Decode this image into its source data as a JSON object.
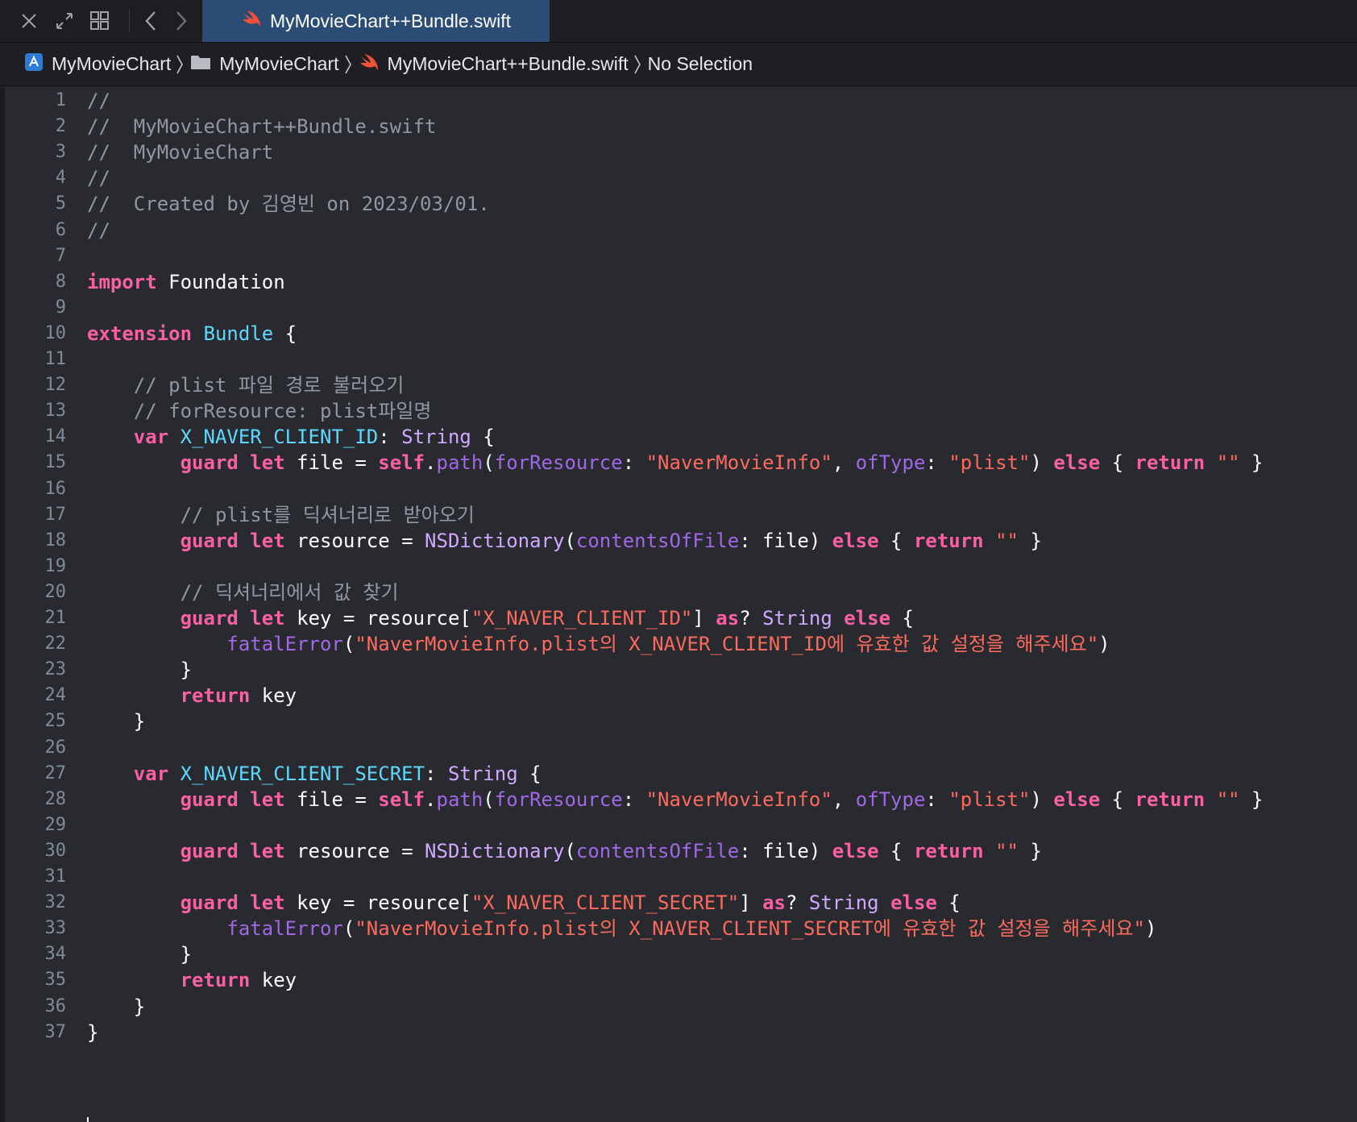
{
  "tabbar": {
    "active_tab_label": "MyMovieChart++Bundle.swift",
    "icons": [
      "close-icon",
      "expand-icon",
      "grid-icon",
      "back-icon",
      "forward-icon"
    ]
  },
  "jumpbar": {
    "project": "MyMovieChart",
    "group": "MyMovieChart",
    "file": "MyMovieChart++Bundle.swift",
    "selection": "No Selection"
  },
  "colors": {
    "comment": "#8d98a3",
    "keyword": "#fc5fa3",
    "type": "#d0a8ff",
    "declared_type": "#5dd8ff",
    "property": "#41a1c0",
    "function": "#a167e6",
    "string": "#fc6a5d",
    "tab_active": "#2b4c74",
    "editor_bg": "#292a30"
  },
  "code_lines": [
    [
      [
        "cm",
        "//"
      ]
    ],
    [
      [
        "cm",
        "//  MyMovieChart++Bundle.swift"
      ]
    ],
    [
      [
        "cm",
        "//  MyMovieChart"
      ]
    ],
    [
      [
        "cm",
        "//"
      ]
    ],
    [
      [
        "cm",
        "//  Created by 김영빈 on 2023/03/01."
      ]
    ],
    [
      [
        "cm",
        "//"
      ]
    ],
    [],
    [
      [
        "kw",
        "import"
      ],
      [
        "pl",
        " Foundation"
      ]
    ],
    [],
    [
      [
        "kw",
        "extension"
      ],
      [
        "pl",
        " "
      ],
      [
        "bt",
        "Bundle"
      ],
      [
        "pl",
        " {"
      ]
    ],
    [],
    [
      [
        "cm",
        "    // plist 파일 경로 불러오기"
      ]
    ],
    [
      [
        "cm",
        "    // forResource: plist파일명"
      ]
    ],
    [
      [
        "pl",
        "    "
      ],
      [
        "kw",
        "var"
      ],
      [
        "pl",
        " "
      ],
      [
        "bt",
        "X_NAVER_CLIENT_ID"
      ],
      [
        "pl",
        ": "
      ],
      [
        "ty",
        "String"
      ],
      [
        "pl",
        " {"
      ]
    ],
    [
      [
        "pl",
        "        "
      ],
      [
        "kw",
        "guard"
      ],
      [
        "pl",
        " "
      ],
      [
        "kw",
        "let"
      ],
      [
        "pl",
        " file = "
      ],
      [
        "kw",
        "self"
      ],
      [
        "pl",
        "."
      ],
      [
        "fn",
        "path"
      ],
      [
        "pl",
        "("
      ],
      [
        "fn",
        "forResource"
      ],
      [
        "pl",
        ": "
      ],
      [
        "st",
        "\"NaverMovieInfo\""
      ],
      [
        "pl",
        ", "
      ],
      [
        "fn",
        "ofType"
      ],
      [
        "pl",
        ": "
      ],
      [
        "st",
        "\"plist\""
      ],
      [
        "pl",
        ") "
      ],
      [
        "kw",
        "else"
      ],
      [
        "pl",
        " { "
      ],
      [
        "kw",
        "return"
      ],
      [
        "pl",
        " "
      ],
      [
        "st",
        "\"\""
      ],
      [
        "pl",
        " }"
      ]
    ],
    [],
    [
      [
        "cm",
        "        // plist를 딕셔너리로 받아오기"
      ]
    ],
    [
      [
        "pl",
        "        "
      ],
      [
        "kw",
        "guard"
      ],
      [
        "pl",
        " "
      ],
      [
        "kw",
        "let"
      ],
      [
        "pl",
        " resource = "
      ],
      [
        "ty",
        "NSDictionary"
      ],
      [
        "pl",
        "("
      ],
      [
        "fn",
        "contentsOfFile"
      ],
      [
        "pl",
        ": file) "
      ],
      [
        "kw",
        "else"
      ],
      [
        "pl",
        " { "
      ],
      [
        "kw",
        "return"
      ],
      [
        "pl",
        " "
      ],
      [
        "st",
        "\"\""
      ],
      [
        "pl",
        " }"
      ]
    ],
    [],
    [
      [
        "cm",
        "        // 딕셔너리에서 값 찾기"
      ]
    ],
    [
      [
        "pl",
        "        "
      ],
      [
        "kw",
        "guard"
      ],
      [
        "pl",
        " "
      ],
      [
        "kw",
        "let"
      ],
      [
        "pl",
        " key = resource["
      ],
      [
        "st",
        "\"X_NAVER_CLIENT_ID\""
      ],
      [
        "pl",
        "] "
      ],
      [
        "kw",
        "as"
      ],
      [
        "pl",
        "? "
      ],
      [
        "ty",
        "String"
      ],
      [
        "pl",
        " "
      ],
      [
        "kw",
        "else"
      ],
      [
        "pl",
        " {"
      ]
    ],
    [
      [
        "pl",
        "            "
      ],
      [
        "fn",
        "fatalError"
      ],
      [
        "pl",
        "("
      ],
      [
        "st",
        "\"NaverMovieInfo.plist의 X_NAVER_CLIENT_ID에 유효한 값 설정을 해주세요\""
      ],
      [
        "pl",
        ")"
      ]
    ],
    [
      [
        "pl",
        "        }"
      ]
    ],
    [
      [
        "pl",
        "        "
      ],
      [
        "kw",
        "return"
      ],
      [
        "pl",
        " key"
      ]
    ],
    [
      [
        "pl",
        "    }"
      ]
    ],
    [],
    [
      [
        "pl",
        "    "
      ],
      [
        "kw",
        "var"
      ],
      [
        "pl",
        " "
      ],
      [
        "bt",
        "X_NAVER_CLIENT_SECRET"
      ],
      [
        "pl",
        ": "
      ],
      [
        "ty",
        "String"
      ],
      [
        "pl",
        " {"
      ]
    ],
    [
      [
        "pl",
        "        "
      ],
      [
        "kw",
        "guard"
      ],
      [
        "pl",
        " "
      ],
      [
        "kw",
        "let"
      ],
      [
        "pl",
        " file = "
      ],
      [
        "kw",
        "self"
      ],
      [
        "pl",
        "."
      ],
      [
        "fn",
        "path"
      ],
      [
        "pl",
        "("
      ],
      [
        "fn",
        "forResource"
      ],
      [
        "pl",
        ": "
      ],
      [
        "st",
        "\"NaverMovieInfo\""
      ],
      [
        "pl",
        ", "
      ],
      [
        "fn",
        "ofType"
      ],
      [
        "pl",
        ": "
      ],
      [
        "st",
        "\"plist\""
      ],
      [
        "pl",
        ") "
      ],
      [
        "kw",
        "else"
      ],
      [
        "pl",
        " { "
      ],
      [
        "kw",
        "return"
      ],
      [
        "pl",
        " "
      ],
      [
        "st",
        "\"\""
      ],
      [
        "pl",
        " }"
      ]
    ],
    [],
    [
      [
        "pl",
        "        "
      ],
      [
        "kw",
        "guard"
      ],
      [
        "pl",
        " "
      ],
      [
        "kw",
        "let"
      ],
      [
        "pl",
        " resource = "
      ],
      [
        "ty",
        "NSDictionary"
      ],
      [
        "pl",
        "("
      ],
      [
        "fn",
        "contentsOfFile"
      ],
      [
        "pl",
        ": file) "
      ],
      [
        "kw",
        "else"
      ],
      [
        "pl",
        " { "
      ],
      [
        "kw",
        "return"
      ],
      [
        "pl",
        " "
      ],
      [
        "st",
        "\"\""
      ],
      [
        "pl",
        " }"
      ]
    ],
    [],
    [
      [
        "pl",
        "        "
      ],
      [
        "kw",
        "guard"
      ],
      [
        "pl",
        " "
      ],
      [
        "kw",
        "let"
      ],
      [
        "pl",
        " key = resource["
      ],
      [
        "st",
        "\"X_NAVER_CLIENT_SECRET\""
      ],
      [
        "pl",
        "] "
      ],
      [
        "kw",
        "as"
      ],
      [
        "pl",
        "? "
      ],
      [
        "ty",
        "String"
      ],
      [
        "pl",
        " "
      ],
      [
        "kw",
        "else"
      ],
      [
        "pl",
        " {"
      ]
    ],
    [
      [
        "pl",
        "            "
      ],
      [
        "fn",
        "fatalError"
      ],
      [
        "pl",
        "("
      ],
      [
        "st",
        "\"NaverMovieInfo.plist의 X_NAVER_CLIENT_SECRET에 유효한 값 설정을 해주세요\""
      ],
      [
        "pl",
        ")"
      ]
    ],
    [
      [
        "pl",
        "        }"
      ]
    ],
    [
      [
        "pl",
        "        "
      ],
      [
        "kw",
        "return"
      ],
      [
        "pl",
        " key"
      ]
    ],
    [
      [
        "pl",
        "    }"
      ]
    ],
    [
      [
        "pl",
        "}"
      ]
    ]
  ]
}
